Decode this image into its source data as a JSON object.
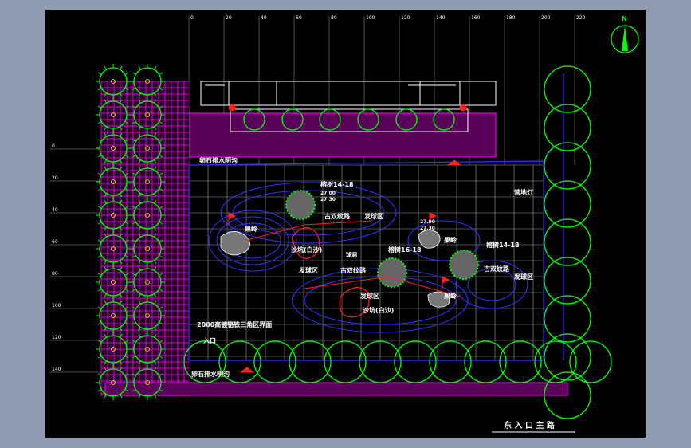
{
  "labels": {
    "edge_drain_top": "卵石排水明沟",
    "edge_drain_bottom": "卵石排水明沟",
    "fence_note": "2000高镀铬铁三角区界面",
    "entrance": "入口",
    "camp_light": "营地灯",
    "north_mark": "N",
    "tree_a": "榕树14-18",
    "tree_b": "榕树14-18",
    "tree_c": "榕树16-18",
    "path_a": "古双纹路",
    "path_b": "古双纹路",
    "path_c": "古双纹路",
    "zone_a": "发球区",
    "zone_b": "发球区",
    "zone_c": "发球区",
    "zone_d": "发球区",
    "sand_a": "沙坑(白沙)",
    "sand_b": "沙坑(白沙)",
    "green_a": "果岭",
    "green_b": "果岭",
    "green_c": "果岭",
    "elev_a": "27.00",
    "elev_b": "27.30",
    "elev_c": "27.00",
    "elev_d": "27.30",
    "hole": "球洞",
    "title_block": "东 入 口 主 路"
  },
  "grid": {
    "top_ticks": [
      "0",
      "20",
      "40",
      "60",
      "80",
      "100",
      "120",
      "140",
      "160",
      "180",
      "200",
      "220"
    ],
    "left_ticks": [
      "0",
      "20",
      "40",
      "60",
      "80",
      "100",
      "120",
      "140"
    ]
  },
  "colors": {
    "background": "#000000",
    "frame": "#8f9bb0",
    "grid": "#9a9a9a",
    "paving": "#ff00ff",
    "trees": "#00ff00",
    "contour": "#3333ff",
    "markers": "#ff2020",
    "labels": "#ffffff"
  }
}
